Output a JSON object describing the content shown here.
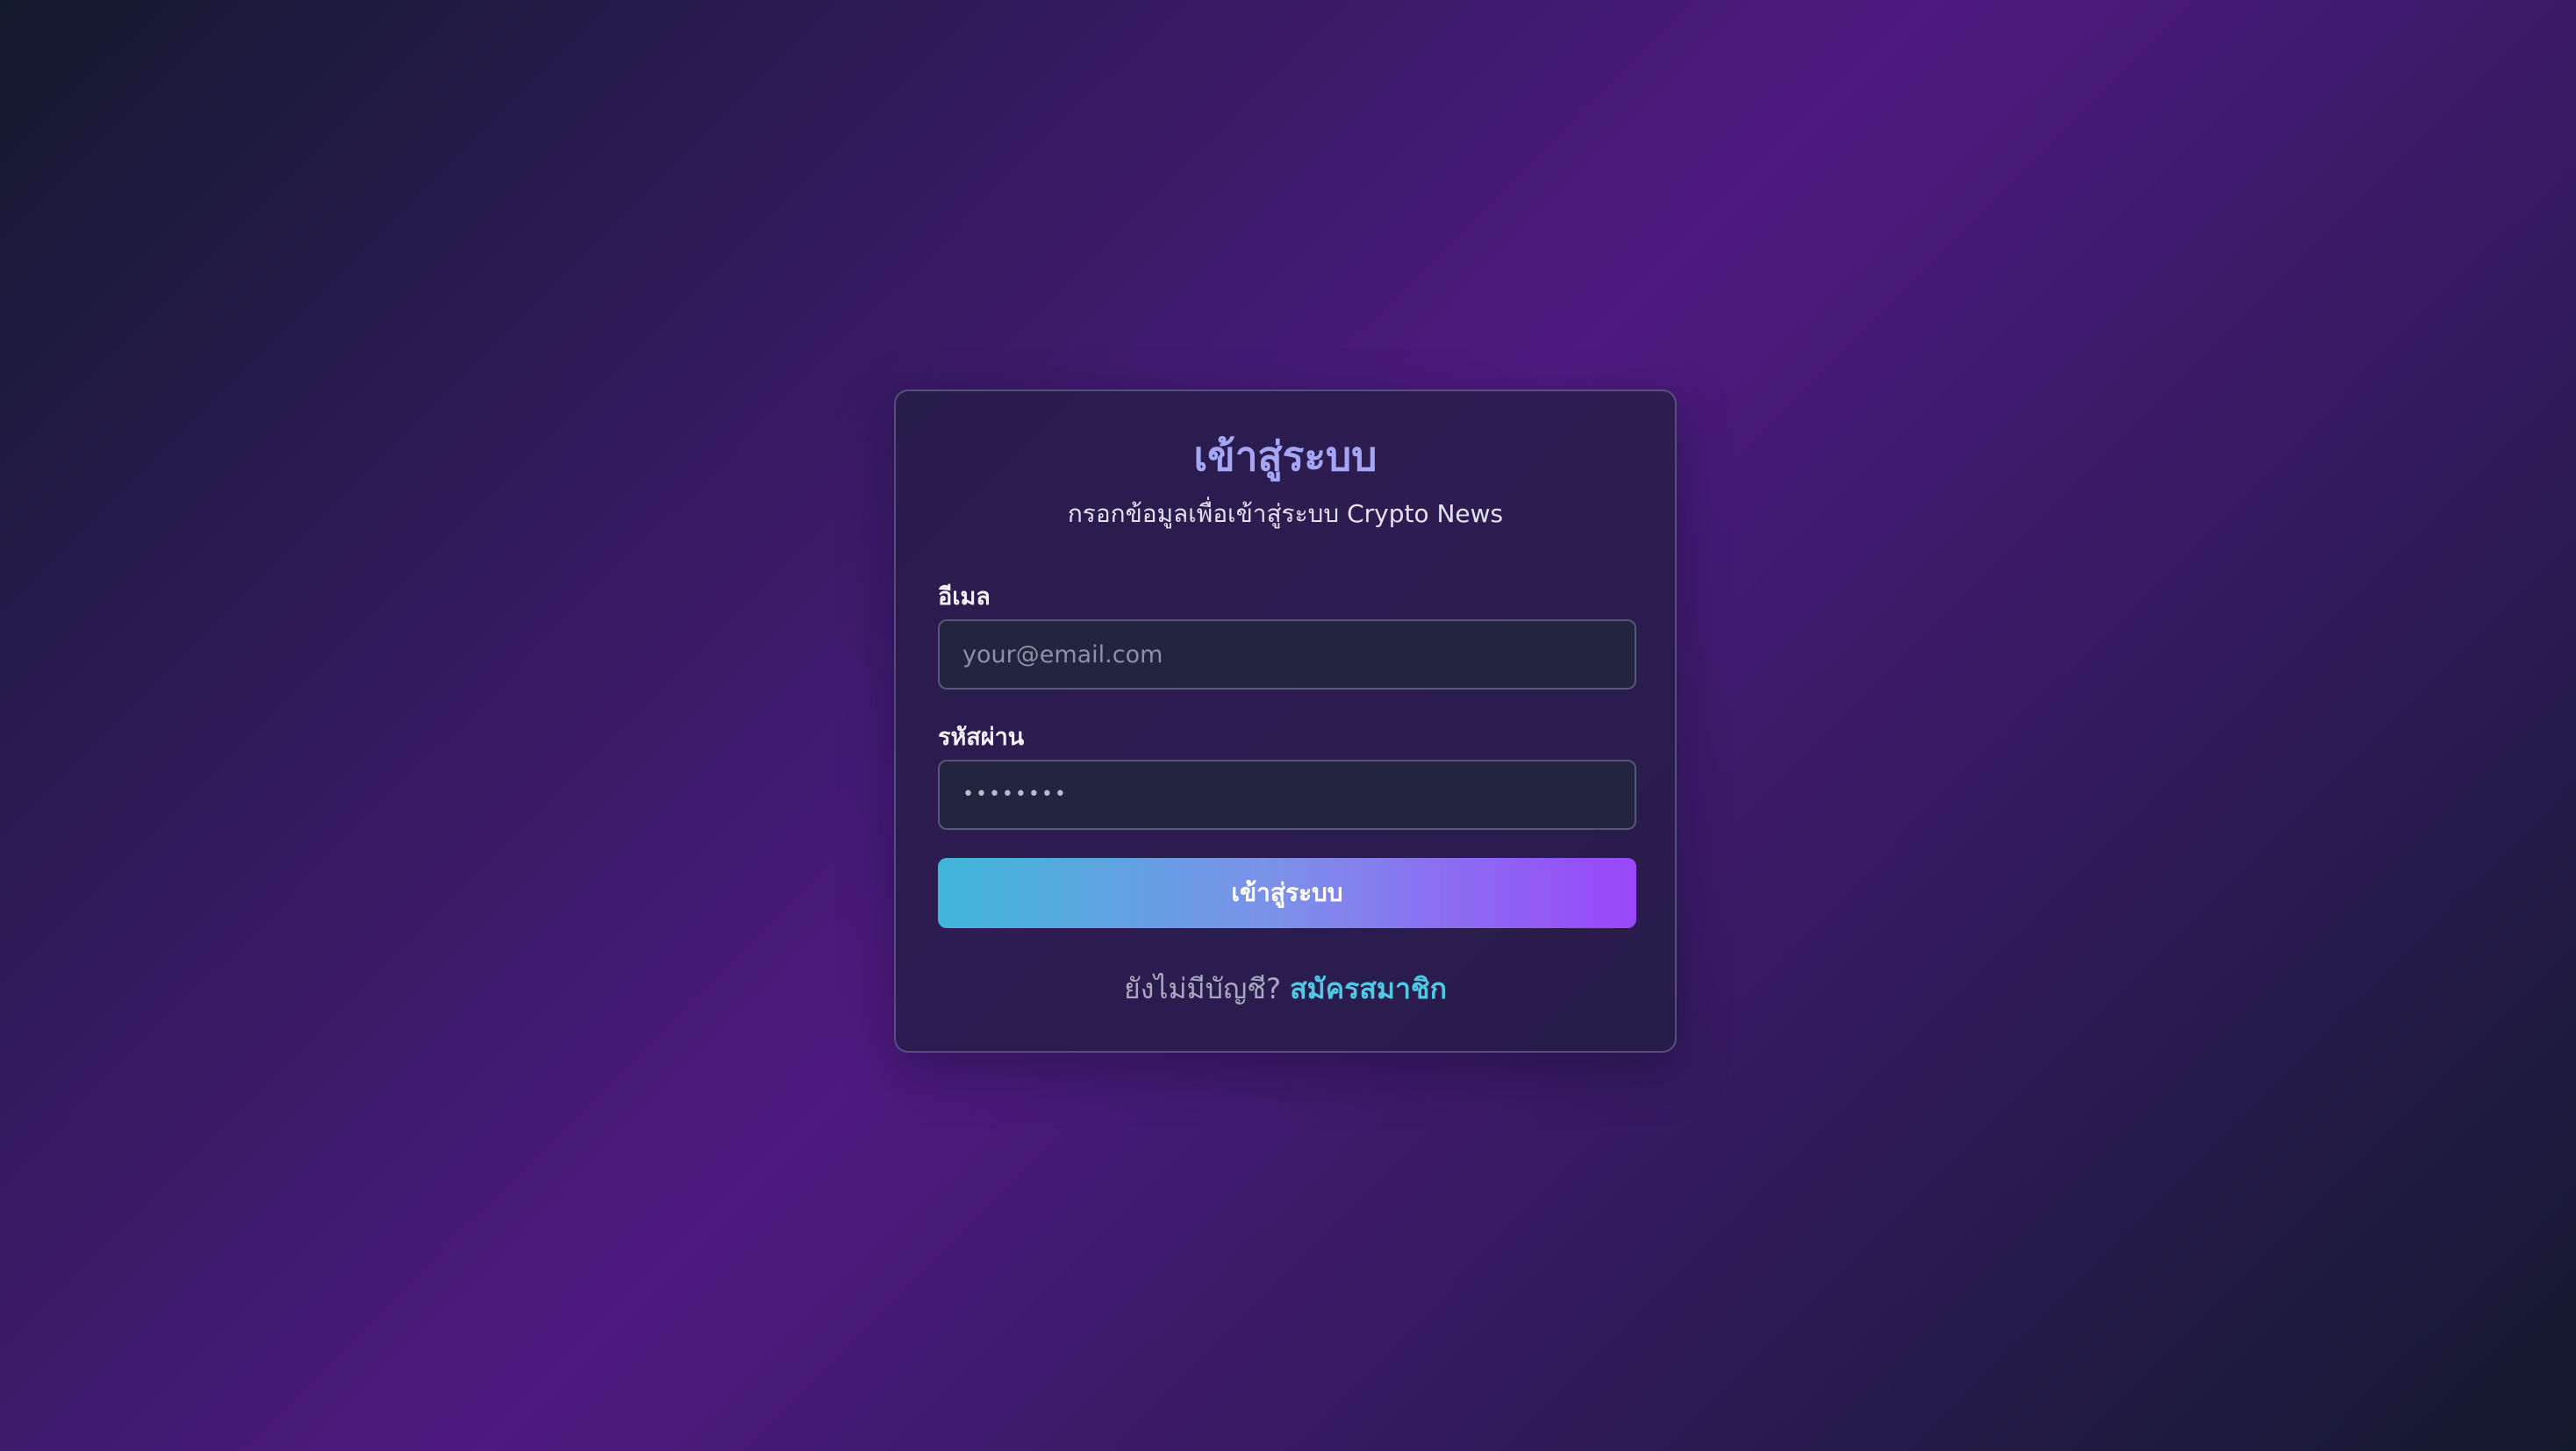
{
  "login": {
    "title": "เข้าสู่ระบบ",
    "subtitle": "กรอกข้อมูลเพื่อเข้าสู่ระบบ Crypto News",
    "email": {
      "label": "อีเมล",
      "value": "",
      "placeholder": "your@email.com"
    },
    "password": {
      "label": "รหัสผ่าน",
      "value": "",
      "placeholder": "••••••••"
    },
    "submit_label": "เข้าสู่ระบบ",
    "footer": {
      "prompt": "ยังไม่มีบัญชี?",
      "signup_link": "สมัครสมาชิก"
    }
  },
  "colors": {
    "title": "#a5a6f6",
    "link": "#4fc9e4",
    "button_gradient_start": "#40b7d9",
    "button_gradient_end": "#9a46fa",
    "card_background": "#241e44",
    "input_background": "#232540"
  }
}
